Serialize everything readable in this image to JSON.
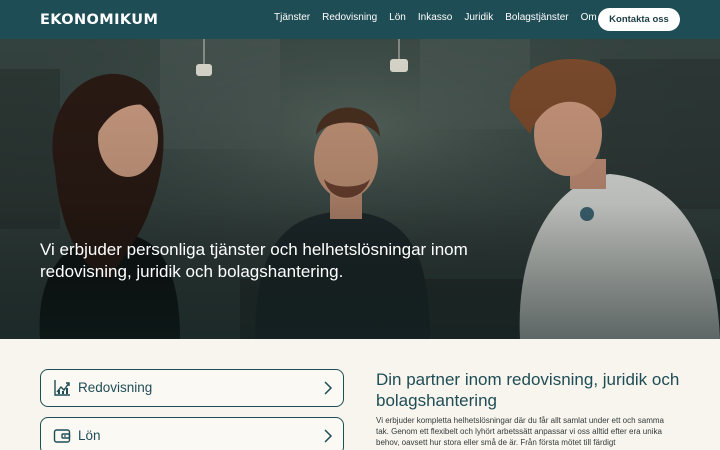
{
  "brand": {
    "logo_text": "EKONOMIKUM"
  },
  "nav": {
    "items": [
      {
        "label": "Tjänster"
      },
      {
        "label": "Redovisning"
      },
      {
        "label": "Lön"
      },
      {
        "label": "Inkasso"
      },
      {
        "label": "Juridik"
      },
      {
        "label": "Bolagstjänster"
      },
      {
        "label": "Om oss"
      }
    ],
    "cta_label": "Kontakta oss"
  },
  "hero": {
    "title": "Vi erbjuder personliga tjänster och helhetslösningar inom redovisning, juridik och bolagshantering."
  },
  "services": [
    {
      "label": "Redovisning",
      "icon": "chart-trend-icon"
    },
    {
      "label": "Lön",
      "icon": "wallet-icon"
    }
  ],
  "intro": {
    "title": "Din partner inom redovisning, juridik och bolagshantering",
    "body": "Vi erbjuder kompletta helhetslösningar där du får allt samlat under ett och samma tak. Genom ett flexibelt och lyhört arbetssätt anpassar vi oss alltid efter era unika behov, oavsett hur stora eller små de är. Från första mötet till färdigt"
  },
  "colors": {
    "header_bg": "#1f4d55",
    "accent": "#1f4d55",
    "page_bg": "#f8f5ee"
  }
}
